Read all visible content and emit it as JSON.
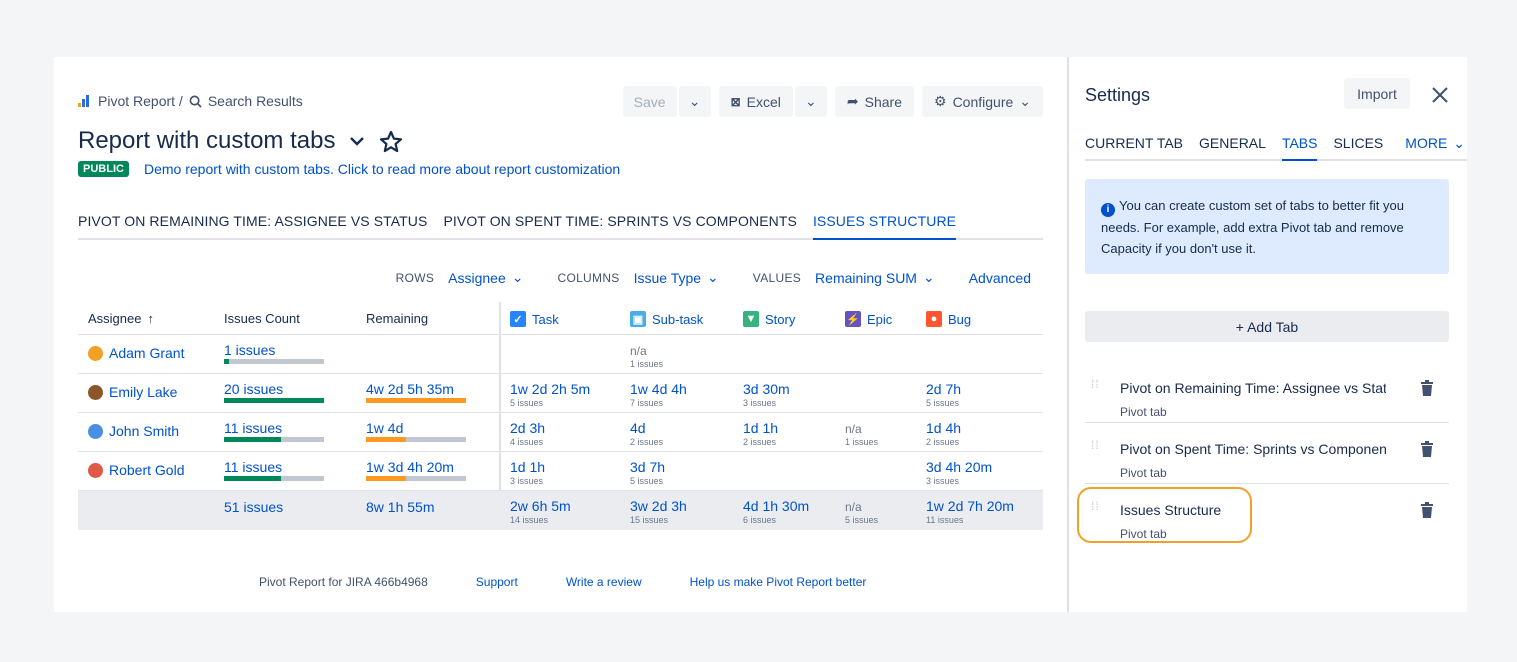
{
  "breadcrumb": {
    "root": "Pivot Report /",
    "current": "Search Results"
  },
  "toolbar": {
    "save": "Save",
    "excel": "Excel",
    "share": "Share",
    "configure": "Configure"
  },
  "report": {
    "title": "Report with custom tabs",
    "badge": "PUBLIC",
    "description": "Demo report with custom tabs. Click to read more about report customization"
  },
  "tabs": [
    {
      "label": "PIVOT ON REMAINING TIME: ASSIGNEE VS STATUS",
      "active": false
    },
    {
      "label": "PIVOT ON SPENT TIME: SPRINTS VS COMPONENTS",
      "active": false
    },
    {
      "label": "ISSUES STRUCTURE",
      "active": true
    }
  ],
  "controls": {
    "rows_label": "ROWS",
    "rows_value": "Assignee",
    "columns_label": "COLUMNS",
    "columns_value": "Issue Type",
    "values_label": "VALUES",
    "values_value": "Remaining SUM",
    "advanced": "Advanced"
  },
  "table": {
    "headers": {
      "assignee": "Assignee",
      "count": "Issues Count",
      "remaining": "Remaining"
    },
    "types": [
      {
        "label": "Task",
        "color": "#2684ff",
        "icon": "✓"
      },
      {
        "label": "Sub-task",
        "color": "#4bade8",
        "icon": "▣"
      },
      {
        "label": "Story",
        "color": "#36b37e",
        "icon": "▼"
      },
      {
        "label": "Epic",
        "color": "#6554c0",
        "icon": "⚡"
      },
      {
        "label": "Bug",
        "color": "#ff5630",
        "icon": "●"
      }
    ],
    "rows": [
      {
        "name": "Adam Grant",
        "avatar": "#f2a126",
        "count": "1 issues",
        "count_fill": 0.05,
        "remaining": "",
        "remaining_fill": 0,
        "cells": [
          {
            "v": "",
            "s": ""
          },
          {
            "v": "n/a",
            "s": "1 issues",
            "na": true
          },
          {
            "v": "",
            "s": ""
          },
          {
            "v": "",
            "s": ""
          },
          {
            "v": "",
            "s": ""
          }
        ]
      },
      {
        "name": "Emily Lake",
        "avatar": "#8b572a",
        "count": "20 issues",
        "count_fill": 1.0,
        "remaining": "4w 2d 5h 35m",
        "remaining_fill": 1.0,
        "cells": [
          {
            "v": "1w 2d 2h 5m",
            "s": "5 issues"
          },
          {
            "v": "1w 4d 4h",
            "s": "7 issues"
          },
          {
            "v": "3d 30m",
            "s": "3 issues"
          },
          {
            "v": "",
            "s": ""
          },
          {
            "v": "2d 7h",
            "s": "5 issues"
          }
        ]
      },
      {
        "name": "John Smith",
        "avatar": "#4a90e2",
        "count": "11 issues",
        "count_fill": 0.57,
        "remaining": "1w 4d",
        "remaining_fill": 0.4,
        "cells": [
          {
            "v": "2d 3h",
            "s": "4 issues"
          },
          {
            "v": "4d",
            "s": "2 issues"
          },
          {
            "v": "1d 1h",
            "s": "2 issues"
          },
          {
            "v": "n/a",
            "s": "1 issues",
            "na": true
          },
          {
            "v": "1d 4h",
            "s": "2 issues"
          }
        ]
      },
      {
        "name": "Robert Gold",
        "avatar": "#e05a47",
        "count": "11 issues",
        "count_fill": 0.57,
        "remaining": "1w 3d 4h 20m",
        "remaining_fill": 0.4,
        "cells": [
          {
            "v": "1d 1h",
            "s": "3 issues"
          },
          {
            "v": "3d 7h",
            "s": "5 issues"
          },
          {
            "v": "",
            "s": ""
          },
          {
            "v": "",
            "s": ""
          },
          {
            "v": "3d 4h 20m",
            "s": "3 issues"
          }
        ]
      }
    ],
    "totals": {
      "count": "51 issues",
      "remaining": "8w 1h 55m",
      "cells": [
        {
          "v": "2w 6h 5m",
          "s": "14 issues"
        },
        {
          "v": "3w 2d 3h",
          "s": "15 issues"
        },
        {
          "v": "4d 1h 30m",
          "s": "6 issues"
        },
        {
          "v": "n/a",
          "s": "5 issues",
          "na": true
        },
        {
          "v": "1w 2d 7h 20m",
          "s": "11 issues"
        }
      ]
    },
    "count_color": "#00875a",
    "remaining_color": "#ff991f"
  },
  "footer": {
    "version": "Pivot Report for JIRA 466b4968",
    "support": "Support",
    "review": "Write a review",
    "better": "Help us make Pivot Report better"
  },
  "settings": {
    "title": "Settings",
    "import": "Import",
    "tabs": [
      "CURRENT TAB",
      "GENERAL",
      "TABS",
      "SLICES"
    ],
    "active_tab": "TABS",
    "more": "MORE",
    "info": "You can create custom set of tabs to better fit you needs. For example, add extra Pivot tab and remove Capacity if you don't use it.",
    "add_tab": "+ Add Tab",
    "items": [
      {
        "title": "Pivot on Remaining Time: Assignee vs Status",
        "sub": "Pivot tab"
      },
      {
        "title": "Pivot on Spent Time: Sprints vs Components",
        "sub": "Pivot tab"
      },
      {
        "title": "Issues Structure",
        "sub": "Pivot tab"
      }
    ]
  }
}
